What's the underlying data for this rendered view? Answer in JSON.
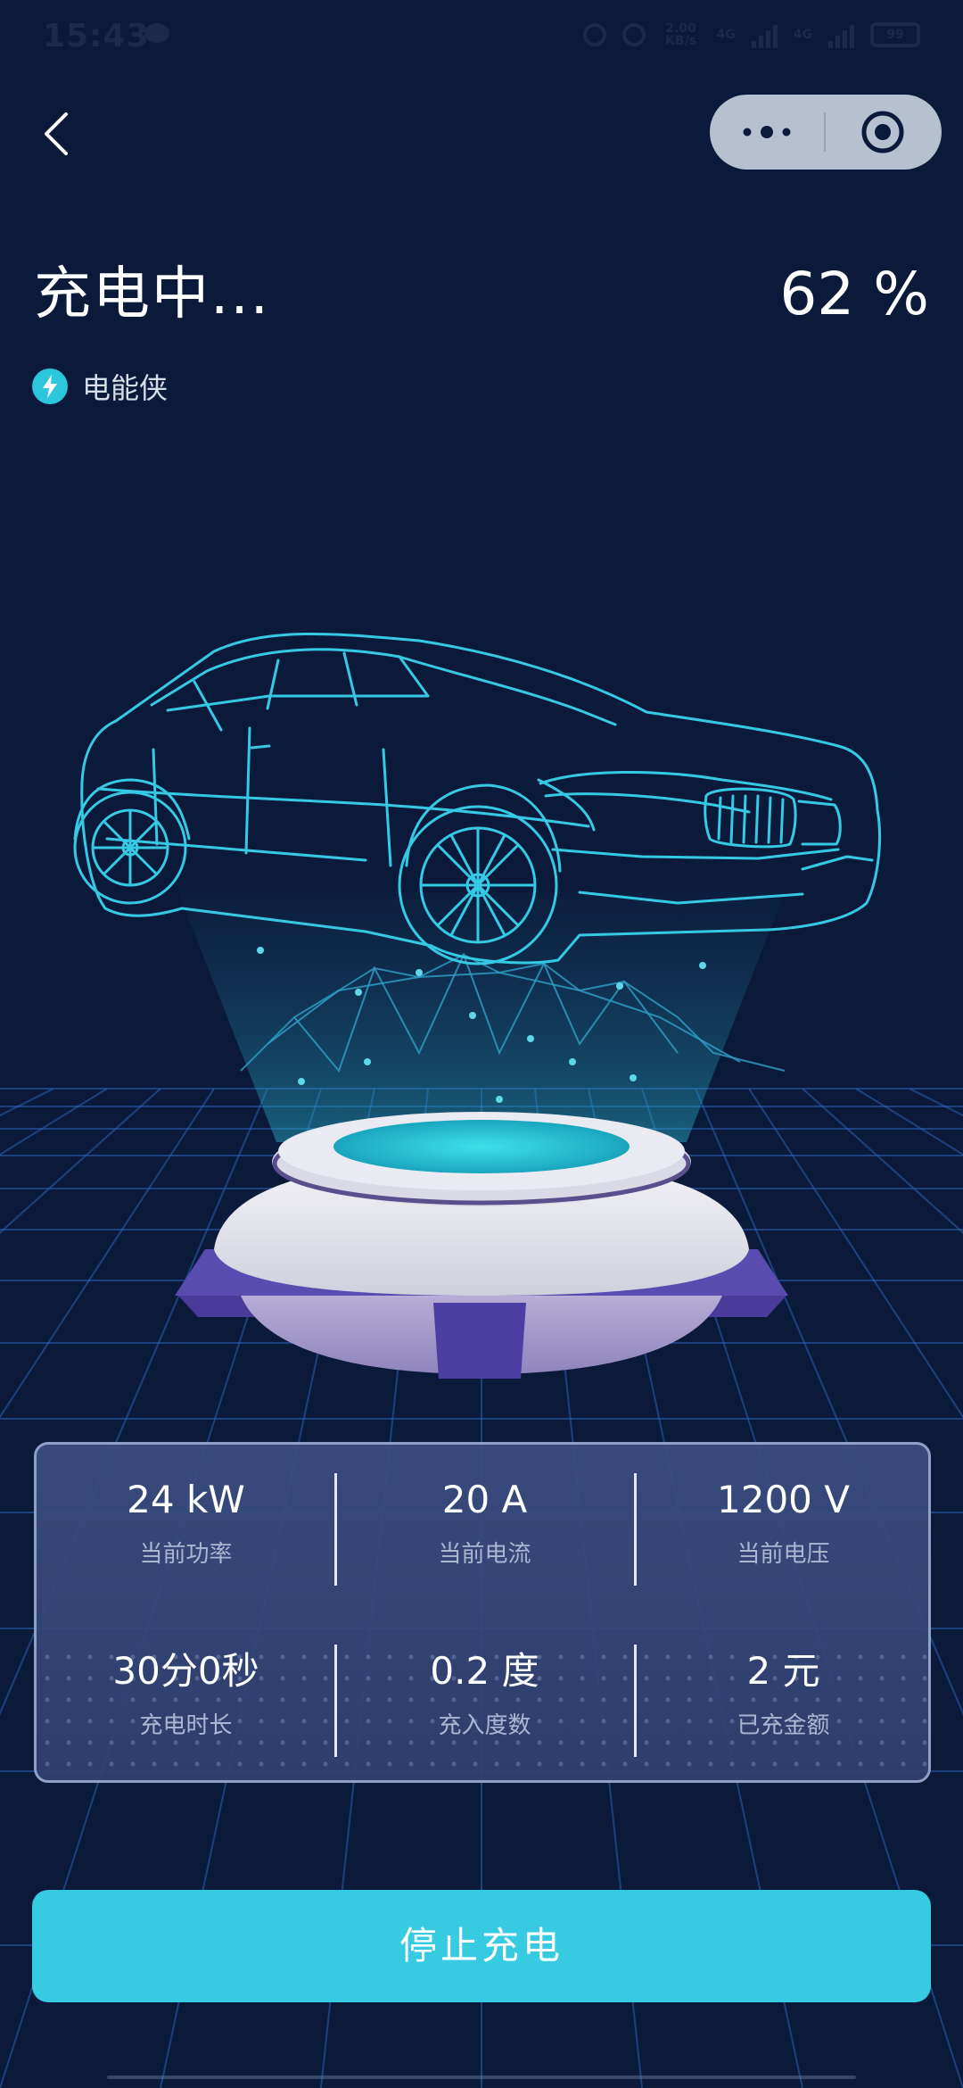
{
  "status_bar": {
    "time": "15:43",
    "net_speed": "2.00 KB/s",
    "network1": "4G",
    "network2": "4G",
    "battery": "99"
  },
  "header": {
    "title": "充电中...",
    "percent": "62 %"
  },
  "brand": {
    "name": "电能侠"
  },
  "stats": [
    {
      "value": "24 kW",
      "label": "当前功率"
    },
    {
      "value": "20 A",
      "label": "当前电流"
    },
    {
      "value": "1200 V",
      "label": "当前电压"
    },
    {
      "value": "30分0秒",
      "label": "充电时长"
    },
    {
      "value": "0.2 度",
      "label": "充入度数"
    },
    {
      "value": "2 元",
      "label": "已充金额"
    }
  ],
  "actions": {
    "stop_label": "停止充电"
  },
  "colors": {
    "background": "#0b1a3a",
    "accent": "#36cbe0",
    "panel": "#3a4c82"
  }
}
